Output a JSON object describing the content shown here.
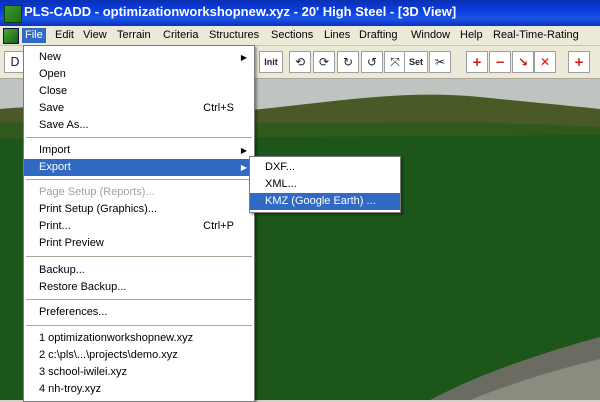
{
  "window": {
    "title": "PLS-CADD - optimizationworkshopnew.xyz -  20' High Steel - [3D View]"
  },
  "menubar": {
    "items": [
      "File",
      "Edit",
      "View",
      "Terrain",
      "Criteria",
      "Structures",
      "Sections",
      "Lines",
      "Drafting",
      "Window",
      "Help",
      "Real-Time-Rating"
    ],
    "active": "File"
  },
  "toolbar": {
    "buttons": [
      {
        "name": "new-doc-icon",
        "label": "D"
      },
      {
        "name": "init-button",
        "label": "Init"
      },
      {
        "name": "rotate-1-icon",
        "label": "⟲"
      },
      {
        "name": "rotate-2-icon",
        "label": "⟳"
      },
      {
        "name": "rotate-3-icon",
        "label": "↻"
      },
      {
        "name": "rotate-4-icon",
        "label": "↺"
      },
      {
        "name": "zoom-extent-icon",
        "label": "⤧"
      },
      {
        "name": "set-button",
        "label": "Set"
      },
      {
        "name": "cut-icon",
        "label": "✂"
      },
      {
        "name": "pi-add-icon",
        "label": "+"
      },
      {
        "name": "pi-delete-icon",
        "label": "−"
      },
      {
        "name": "pi-move-icon",
        "label": "↘"
      },
      {
        "name": "pi-remove-icon",
        "label": "✕"
      },
      {
        "name": "add-structure-icon",
        "label": "+"
      }
    ]
  },
  "file_menu": {
    "items": [
      {
        "label": "New",
        "shortcut": "",
        "submenu": true
      },
      {
        "label": "Open",
        "shortcut": ""
      },
      {
        "label": "Close",
        "shortcut": ""
      },
      {
        "label": "Save",
        "shortcut": "Ctrl+S"
      },
      {
        "label": "Save As...",
        "shortcut": ""
      },
      {
        "label": "Import",
        "shortcut": "",
        "submenu": true
      },
      {
        "label": "Export",
        "shortcut": "",
        "submenu": true,
        "highlighted": true
      },
      {
        "label": "Page Setup (Reports)...",
        "shortcut": "",
        "disabled": true
      },
      {
        "label": "Print Setup (Graphics)...",
        "shortcut": ""
      },
      {
        "label": "Print...",
        "shortcut": "Ctrl+P"
      },
      {
        "label": "Print Preview",
        "shortcut": ""
      },
      {
        "label": "Backup...",
        "shortcut": ""
      },
      {
        "label": "Restore Backup...",
        "shortcut": ""
      },
      {
        "label": "Preferences...",
        "shortcut": ""
      },
      {
        "label": "1 optimizationworkshopnew.xyz",
        "shortcut": ""
      },
      {
        "label": "2 c:\\pls\\...\\projects\\demo.xyz",
        "shortcut": ""
      },
      {
        "label": "3 school-iwilei.xyz",
        "shortcut": ""
      },
      {
        "label": "4 nh-troy.xyz",
        "shortcut": ""
      }
    ]
  },
  "export_submenu": {
    "items": [
      {
        "label": "DXF..."
      },
      {
        "label": "XML..."
      },
      {
        "label": "KMZ (Google Earth) ...",
        "highlighted": true
      }
    ]
  },
  "colors": {
    "title_bar": "#0b3ee0",
    "highlight": "#316ac5",
    "terrain": "#1e5a1c",
    "sky": "#c0c4c0"
  }
}
